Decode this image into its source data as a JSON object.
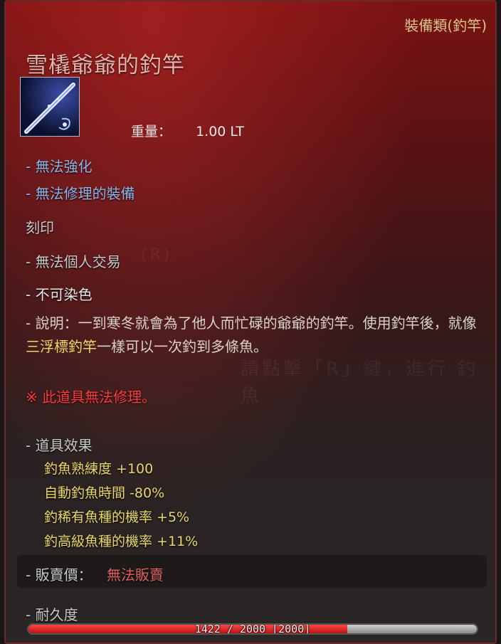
{
  "tooltip": {
    "category": "裝備類(釣竿)",
    "item_name": "雪橇爺爺的釣竿",
    "weight_label": "重量：",
    "weight_value": "1.00 LT",
    "properties": [
      "- 無法強化",
      "- 無法修理的裝備"
    ],
    "engrave_label": "刻印",
    "trade": "- 無法個人交易",
    "dye": "- 不可染色",
    "description": {
      "prefix": "- 說明：一到寒冬就會為了他人而忙碌的爺爺的釣竿。使用釣竿後，就像",
      "highlight": "三浮標釣竿",
      "suffix": "一樣可以一次釣到多條魚。"
    },
    "warning": "※ 此道具無法修理。",
    "effects_header": "- 道具效果",
    "effects": [
      "釣魚熟練度 +100",
      "自動釣魚時間 -80%",
      "釣稀有魚種的機率 +5%",
      "釣高級魚種的機率 +11%"
    ],
    "sell_label": "- 販賣價：",
    "sell_value": "無法販賣",
    "durability_label": "- 耐久度",
    "durability_text": "1422 / 2000 [2000]",
    "durability_fraction": 0.711,
    "colors": {
      "accent_red": "#ff3a3a",
      "effect_yellow": "#e8d86a",
      "property_blue": "#8fb4e8"
    },
    "icon": "fishing-rod-icon"
  },
  "background": {
    "hint": "請點擊「R」鍵，進行 釣魚",
    "key": "(R)"
  }
}
